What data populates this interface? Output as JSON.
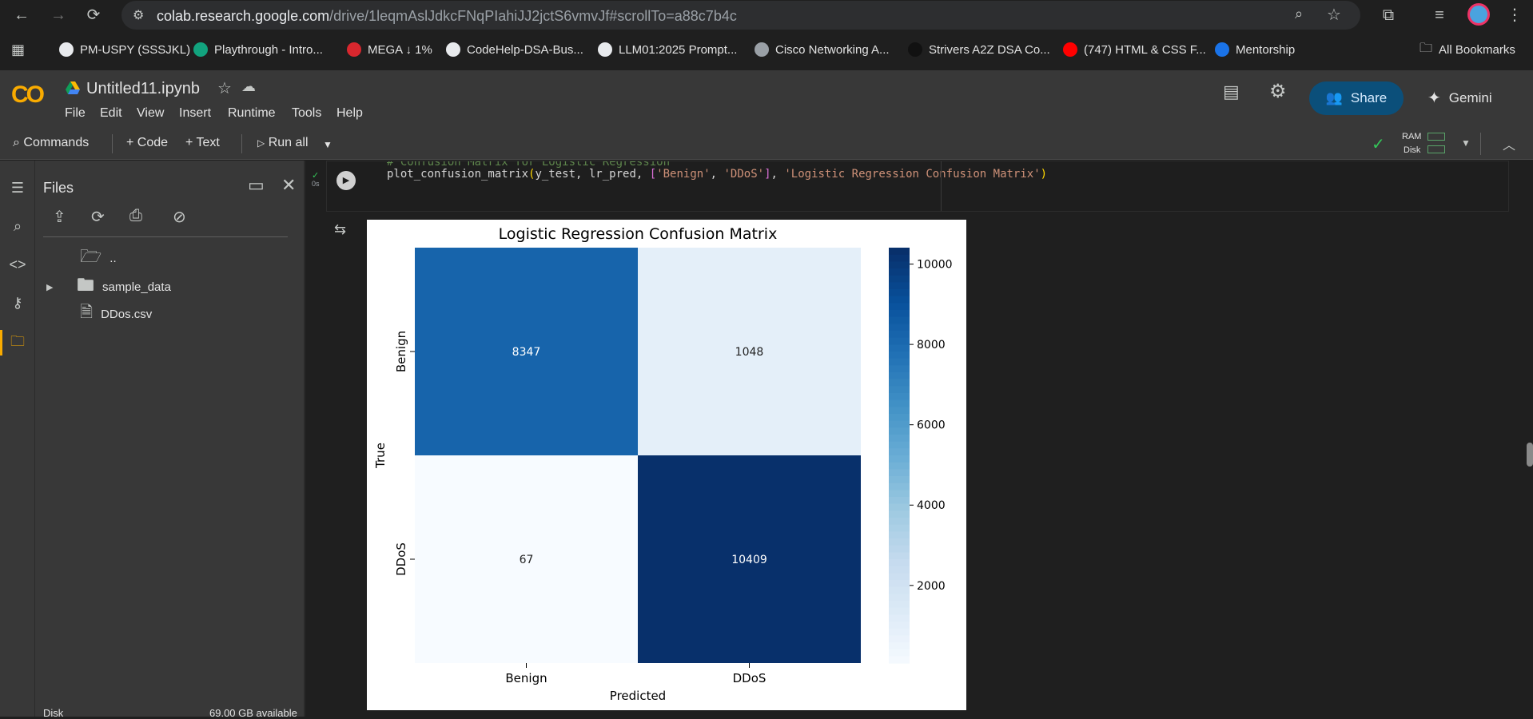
{
  "browser": {
    "url_host": "colab.research.google.com",
    "url_path": "/drive/1leqmAslJdkcFNqPIahiJJ2jctS6vmvJf#scrollTo=a88c7b4c",
    "bookmarks": [
      {
        "label": "PM-USPY (SSSJKL)",
        "color": "#e8eaed"
      },
      {
        "label": "Playthrough - Intro...",
        "color": "#12a37e"
      },
      {
        "label": "MEGA ↓ 1%",
        "color": "#d9272e"
      },
      {
        "label": "CodeHelp-DSA-Bus...",
        "color": "#e8eaed"
      },
      {
        "label": "LLM01:2025 Prompt...",
        "color": "#e8eaed"
      },
      {
        "label": "Cisco Networking A...",
        "color": "#9aa0a6"
      },
      {
        "label": "Strivers A2Z DSA Co...",
        "color": "#111111"
      },
      {
        "label": "(747) HTML & CSS F...",
        "color": "#ff0000"
      },
      {
        "label": "Mentorship",
        "color": "#1a73e8"
      }
    ],
    "all_bookmarks": "All Bookmarks"
  },
  "colab": {
    "logo": "CO",
    "notebook_name": "Untitled11.ipynb",
    "menu": [
      "File",
      "Edit",
      "View",
      "Insert",
      "Runtime",
      "Tools",
      "Help"
    ],
    "share_label": "Share",
    "gemini_label": "Gemini",
    "toolbar": {
      "commands": "Commands",
      "code": "+ Code",
      "text": "+ Text",
      "run_all": "Run all",
      "ram": "RAM",
      "disk": "Disk"
    }
  },
  "files_panel": {
    "title": "Files",
    "items": [
      {
        "name": "..",
        "type": "folder-up"
      },
      {
        "name": "sample_data",
        "type": "folder"
      },
      {
        "name": "DDos.csv",
        "type": "file"
      }
    ],
    "footer_label": "Disk",
    "footer_value": "69.00 GB available"
  },
  "cell": {
    "exec_time": "0s",
    "comment": "# Confusion Matrix for Logistic Regression",
    "code_fn": "plot_confusion_matrix",
    "code_args_plain": "y_test, lr_pred, ",
    "code_list_items": [
      "'Benign'",
      "'DDoS'"
    ],
    "code_title_arg": "'Logistic Regression Confusion Matrix'"
  },
  "chart_data": {
    "type": "heatmap",
    "title": "Logistic Regression Confusion Matrix",
    "xlabel": "Predicted",
    "ylabel": "True",
    "x_categories": [
      "Benign",
      "DDoS"
    ],
    "y_categories": [
      "Benign",
      "DDoS"
    ],
    "matrix": [
      [
        8347,
        1048
      ],
      [
        67,
        10409
      ]
    ],
    "colormap": "Blues",
    "colorbar": {
      "min": 67,
      "max": 10409,
      "ticks": [
        2000,
        4000,
        6000,
        8000,
        10000
      ]
    }
  }
}
